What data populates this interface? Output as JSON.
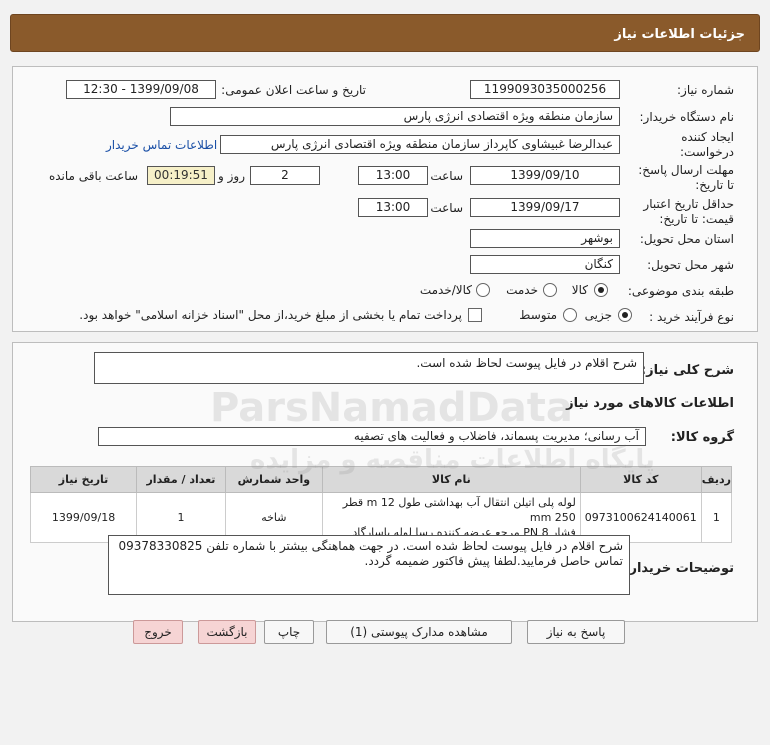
{
  "page": {
    "title": "جزئیات اطلاعات نیاز"
  },
  "need": {
    "number_label": "شماره نیاز:",
    "number": "1199093035000256",
    "announce_label": "تاریخ و ساعت اعلان عمومی:",
    "announce": "1399/09/08 - 12:30",
    "buyer_org_label": "نام دستگاه خریدار:",
    "buyer_org": "سازمان منطقه ویژه اقتصادی انرژی پارس",
    "creator_label_1": "ایجاد کننده",
    "creator_label_2": "درخواست:",
    "creator": "عبدالرضا غبیشاوی کاپرداز سازمان منطقه ویژه اقتصادی انرژی پارس",
    "contact_link": "اطلاعات تماس خریدار",
    "reply_label_1": "مهلت ارسال پاسخ:",
    "reply_label_2": "تا تاریخ:",
    "reply_date": "1399/09/10",
    "time_label": "ساعت",
    "reply_time": "13:00",
    "days": "2",
    "days_label": "روز و",
    "remaining": "00:19:51",
    "remaining_label": "ساعت باقی مانده",
    "validity_label_1": "حداقل تاریخ اعتبار",
    "validity_label_2": "قیمت: تا تاریخ:",
    "validity_date": "1399/09/17",
    "validity_time": "13:00",
    "province_label": "استان محل تحویل:",
    "province": "بوشهر",
    "city_label": "شهر محل تحویل:",
    "city": "کنگان",
    "category_label": "طبقه بندی موضوعی:",
    "category_options": [
      "کالا",
      "خدمت",
      "کالا/خدمت"
    ],
    "process_label": "نوع فرآیند خرید :",
    "process_options": [
      "جزیی",
      "متوسط"
    ],
    "treasury_note": "پرداخت تمام یا بخشی از مبلغ خرید،از محل \"اسناد خزانه اسلامی\" خواهد بود."
  },
  "summary": {
    "label": "شرح کلی نیاز:",
    "text": "شرح اقلام در فایل پیوست لحاظ شده است."
  },
  "goods": {
    "section_title": "اطلاعات کالاهای مورد نیاز",
    "group_label": "گروه کالا:",
    "group": "آب رسانی؛ مدیریت پسماند، فاضلاب و فعالیت های تصفیه",
    "columns": [
      "ردیف",
      "کد کالا",
      "نام کالا",
      "واحد شمارش",
      "تعداد / مقدار",
      "تاریخ نیاز"
    ],
    "rows": [
      {
        "row": "1",
        "code": "0973100624140061",
        "name_line1": "لوله پلی اتیلن انتقال آب بهداشتی طول 12 m قطر 250 mm",
        "name_line2": "فشار 8 PN مرجع عرضه کننده رسا لوله پاسارگاد",
        "unit": "شاخه",
        "qty": "1",
        "date": "1399/09/18"
      }
    ]
  },
  "buyer_notes": {
    "label": "توضیحات خریدار:",
    "line1": "شرح اقلام در فایل پیوست لحاظ شده است. در جهت هماهنگی بیشتر با شماره تلفن 09378330825",
    "line2": "تماس حاصل فرمایید.لطفا پیش فاکتور ضمیمه گردد."
  },
  "buttons": {
    "reply": "پاسخ به نیاز",
    "docs": "مشاهده مدارک پیوستی (1)",
    "print": "چاپ",
    "back": "بازگشت",
    "exit": "خروج"
  },
  "watermark": {
    "brand": "ParsNamadData",
    "fa": "پایگاه اطلاعات مناقصه و مزایده"
  }
}
